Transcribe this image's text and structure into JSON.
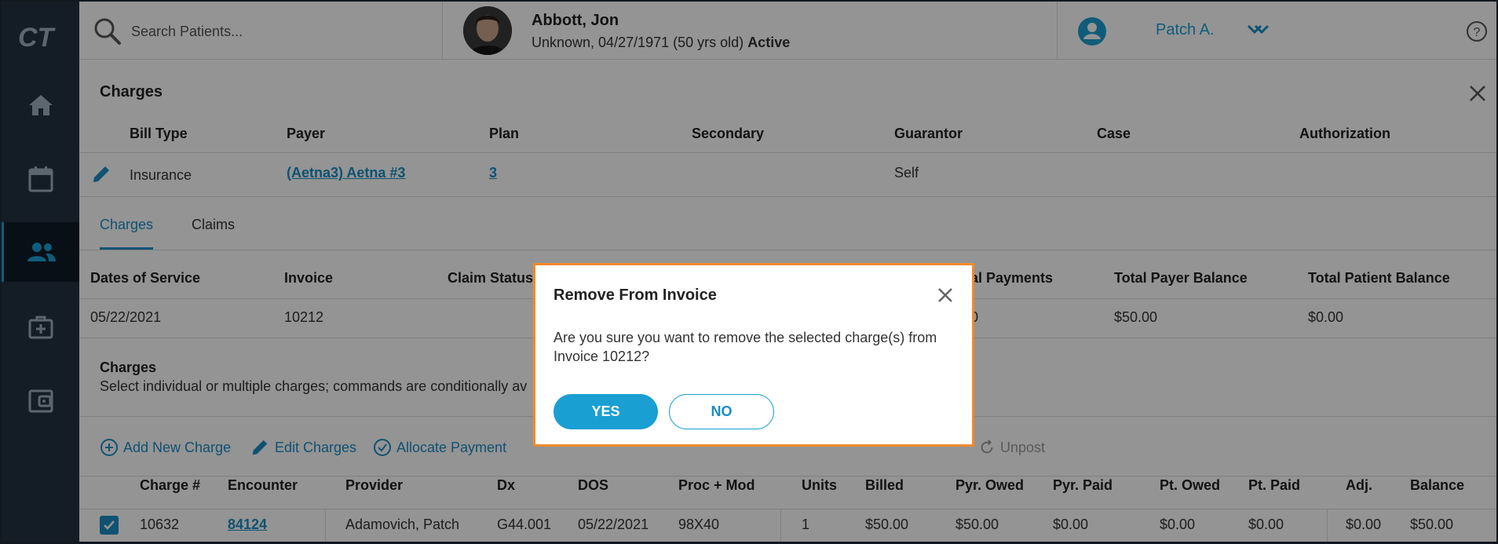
{
  "sidebar": {
    "logo": "CT",
    "items": [
      {
        "icon": "home-icon"
      },
      {
        "icon": "calendar-icon"
      },
      {
        "icon": "patients-icon",
        "active": true
      },
      {
        "icon": "medical-kit-icon"
      },
      {
        "icon": "wallet-icon"
      }
    ]
  },
  "topbar": {
    "search_placeholder": "Search Patients...",
    "patient_name": "Abbott, Jon",
    "patient_details": "Unknown, 04/27/1971 (50 yrs old)",
    "patient_status": "Active",
    "user_name": "Patch A."
  },
  "charges_panel": {
    "title": "Charges",
    "bill_headers": [
      "Bill Type",
      "Payer",
      "Plan",
      "Secondary",
      "Guarantor",
      "Case",
      "Authorization"
    ],
    "bill_row": {
      "bill_type": "Insurance",
      "payer": "(Aetna3) Aetna #3",
      "plan": "3",
      "secondary": "",
      "guarantor": "Self",
      "case": "",
      "authorization": ""
    },
    "tabs": [
      "Charges",
      "Claims"
    ],
    "invoice_headers": [
      "Dates of Service",
      "Invoice",
      "Claim Status",
      "al Payments",
      "Total Payer Balance",
      "Total Patient Balance"
    ],
    "invoice_row": {
      "dates_of_service": "05/22/2021",
      "invoice": "10212",
      "total_payments": "0",
      "total_payer_balance": "$50.00",
      "total_patient_balance": "$0.00"
    },
    "charges_section_title": "Charges",
    "charges_section_desc": "Select individual or multiple charges; commands are conditionally av",
    "toolbar": {
      "add_new_charge": "Add New Charge",
      "edit_charges": "Edit Charges",
      "allocate_payment": "Allocate Payment",
      "unpost": "Unpost"
    },
    "table_headers": [
      "Charge #",
      "Encounter",
      "Provider",
      "Dx",
      "DOS",
      "Proc + Mod",
      "Units",
      "Billed",
      "Pyr. Owed",
      "Pyr. Paid",
      "Pt. Owed",
      "Pt. Paid",
      "Adj.",
      "Balance"
    ],
    "rows": [
      {
        "checked": true,
        "charge_no": "10632",
        "encounter": "84124",
        "provider": "Adamovich, Patch",
        "dx": "G44.001",
        "dos": "05/22/2021",
        "proc_mod": "98X40",
        "units": "1",
        "billed": "$50.00",
        "pyr_owed": "$50.00",
        "pyr_paid": "$0.00",
        "pt_owed": "$0.00",
        "pt_paid": "$0.00",
        "adj": "$0.00",
        "balance": "$50.00"
      }
    ]
  },
  "dialog": {
    "title": "Remove From Invoice",
    "message": "Are you sure you want to remove the selected charge(s) from Invoice 10212?",
    "yes_label": "YES",
    "no_label": "NO"
  },
  "colors": {
    "accent": "#1a9fd3",
    "sidebar": "#243342",
    "dialog_border": "#f08a2a"
  }
}
